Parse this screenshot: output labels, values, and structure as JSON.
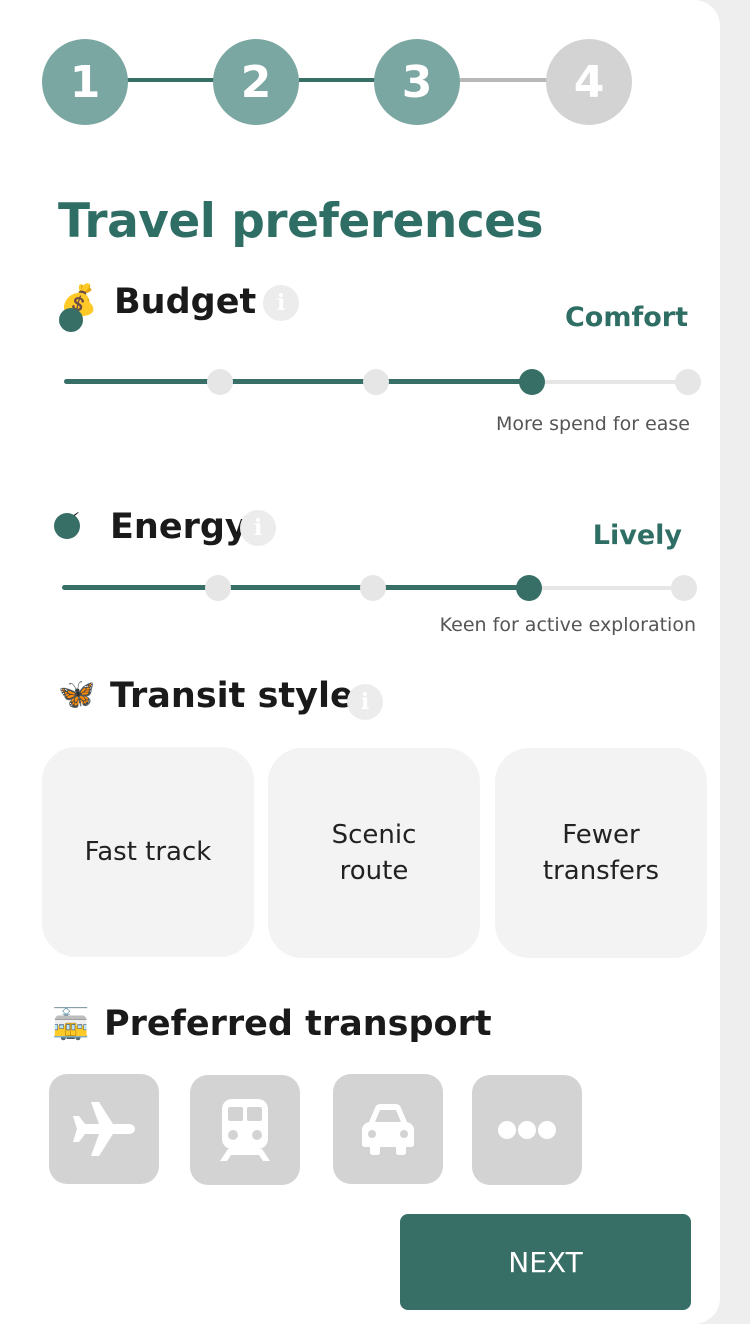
{
  "stepper": {
    "steps": [
      {
        "label": "1",
        "state": "done"
      },
      {
        "label": "2",
        "state": "done"
      },
      {
        "label": "3",
        "state": "current"
      },
      {
        "label": "4",
        "state": "todo"
      }
    ]
  },
  "page_title": "Travel preferences",
  "budget": {
    "icon": "money-bag-icon",
    "glyph": "💰",
    "title": "Budget",
    "value_label": "Comfort",
    "hint": "More spend for ease",
    "level_index": 3,
    "level_count": 5
  },
  "energy": {
    "icon": "lightning-icon",
    "glyph": "⚡",
    "title": "Energy",
    "value_label": "Lively",
    "hint": "Keen for active exploration",
    "level_index": 3,
    "level_count": 5
  },
  "transit": {
    "icon": "butterfly-icon",
    "glyph": "🦋",
    "title": "Transit style",
    "options": [
      {
        "label": "Fast track"
      },
      {
        "label": "Scenic route"
      },
      {
        "label": "Fewer transfers"
      }
    ]
  },
  "transport": {
    "icon": "tram-icon",
    "glyph": "🚋",
    "title": "Preferred transport",
    "options": [
      {
        "icon": "airplane-icon"
      },
      {
        "icon": "train-icon"
      },
      {
        "icon": "car-icon"
      },
      {
        "icon": "more-icon"
      }
    ]
  },
  "info_glyph": "i",
  "next_label": "NEXT",
  "colors": {
    "primary": "#376f66",
    "step_done": "#7aa7a2",
    "step_todo": "#d3d3d3",
    "title": "#2f6e64",
    "card_bg": "#f3f3f3",
    "icon_bg": "#d3d3d3"
  }
}
